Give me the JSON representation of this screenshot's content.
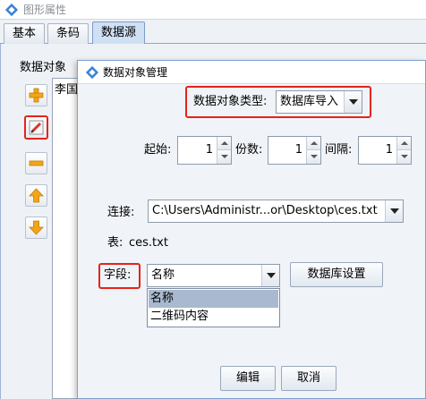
{
  "window": {
    "title": "图形属性"
  },
  "tabs": [
    {
      "label": "基本"
    },
    {
      "label": "条码"
    },
    {
      "label": "数据源"
    }
  ],
  "datasource": {
    "section_label": "数据对象",
    "list_items": [
      "李国"
    ]
  },
  "toolbar": {
    "icons": [
      "add-icon",
      "edit-icon",
      "remove-icon",
      "move-up-icon",
      "move-down-icon"
    ]
  },
  "dialog": {
    "title": "数据对象管理",
    "type_label": "数据对象类型:",
    "type_value": "数据库导入",
    "start_label": "起始:",
    "start_value": "1",
    "copies_label": "份数:",
    "copies_value": "1",
    "interval_label": "间隔:",
    "interval_value": "1",
    "connection_label": "连接:",
    "connection_value": "C:\\Users\\Administr...or\\Desktop\\ces.txt",
    "table_label": "表:",
    "table_value": "ces.txt",
    "field_label": "字段:",
    "field_value": "名称",
    "db_settings_button": "数据库设置",
    "field_options": [
      "名称",
      "二维码内容"
    ],
    "edit_button": "编辑",
    "cancel_button": "取消"
  },
  "colors": {
    "highlight_border": "#e5231b",
    "accent": "#cfe0f4",
    "selected_option": "#a9b9cf"
  }
}
